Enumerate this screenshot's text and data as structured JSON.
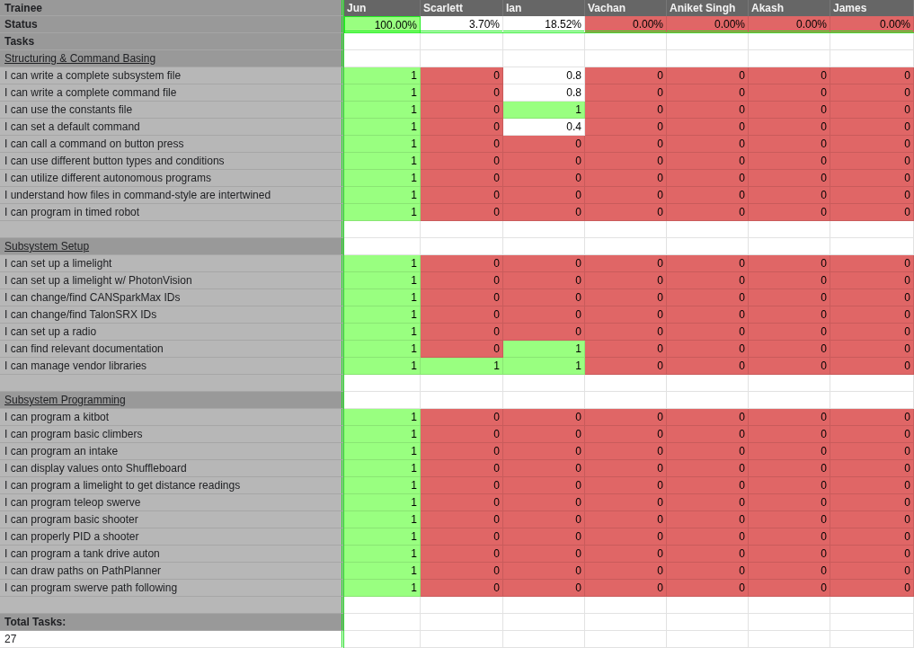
{
  "header": {
    "label": "Trainee",
    "trainees": [
      "Jun",
      "Scarlett",
      "Ian",
      "Vachan",
      "Aniket Singh",
      "Akash",
      "James"
    ]
  },
  "status": {
    "label": "Status",
    "cells": [
      {
        "value": "100.00%",
        "color": "#99ff80"
      },
      {
        "value": "3.70%",
        "color": "#ffffff"
      },
      {
        "value": "18.52%",
        "color": "#ffffff"
      },
      {
        "value": "0.00%",
        "color": "#e06666"
      },
      {
        "value": "0.00%",
        "color": "#e06666"
      },
      {
        "value": "0.00%",
        "color": "#e06666"
      },
      {
        "value": "0.00%",
        "color": "#e06666"
      }
    ]
  },
  "tasks_label": "Tasks",
  "sections": [
    {
      "title": "Structuring & Command Basing",
      "rows": [
        {
          "label": "I can write a complete subsystem file",
          "cells": [
            {
              "value": "1",
              "color": "#99ff80"
            },
            {
              "value": "0",
              "color": "#e06666"
            },
            {
              "value": "0.8",
              "color": "#ffffff"
            },
            {
              "value": "0",
              "color": "#e06666"
            },
            {
              "value": "0",
              "color": "#e06666"
            },
            {
              "value": "0",
              "color": "#e06666"
            },
            {
              "value": "0",
              "color": "#e06666"
            }
          ]
        },
        {
          "label": "I can write a complete command file",
          "cells": [
            {
              "value": "1",
              "color": "#99ff80"
            },
            {
              "value": "0",
              "color": "#e06666"
            },
            {
              "value": "0.8",
              "color": "#ffffff"
            },
            {
              "value": "0",
              "color": "#e06666"
            },
            {
              "value": "0",
              "color": "#e06666"
            },
            {
              "value": "0",
              "color": "#e06666"
            },
            {
              "value": "0",
              "color": "#e06666"
            }
          ]
        },
        {
          "label": "I can use the constants file",
          "cells": [
            {
              "value": "1",
              "color": "#99ff80"
            },
            {
              "value": "0",
              "color": "#e06666"
            },
            {
              "value": "1",
              "color": "#99ff80"
            },
            {
              "value": "0",
              "color": "#e06666"
            },
            {
              "value": "0",
              "color": "#e06666"
            },
            {
              "value": "0",
              "color": "#e06666"
            },
            {
              "value": "0",
              "color": "#e06666"
            }
          ]
        },
        {
          "label": "I can set a default command",
          "cells": [
            {
              "value": "1",
              "color": "#99ff80"
            },
            {
              "value": "0",
              "color": "#e06666"
            },
            {
              "value": "0.4",
              "color": "#ffffff"
            },
            {
              "value": "0",
              "color": "#e06666"
            },
            {
              "value": "0",
              "color": "#e06666"
            },
            {
              "value": "0",
              "color": "#e06666"
            },
            {
              "value": "0",
              "color": "#e06666"
            }
          ]
        },
        {
          "label": "I can call a command on button press",
          "cells": [
            {
              "value": "1",
              "color": "#99ff80"
            },
            {
              "value": "0",
              "color": "#e06666"
            },
            {
              "value": "0",
              "color": "#e06666"
            },
            {
              "value": "0",
              "color": "#e06666"
            },
            {
              "value": "0",
              "color": "#e06666"
            },
            {
              "value": "0",
              "color": "#e06666"
            },
            {
              "value": "0",
              "color": "#e06666"
            }
          ]
        },
        {
          "label": "I can use different button types and conditions",
          "cells": [
            {
              "value": "1",
              "color": "#99ff80"
            },
            {
              "value": "0",
              "color": "#e06666"
            },
            {
              "value": "0",
              "color": "#e06666"
            },
            {
              "value": "0",
              "color": "#e06666"
            },
            {
              "value": "0",
              "color": "#e06666"
            },
            {
              "value": "0",
              "color": "#e06666"
            },
            {
              "value": "0",
              "color": "#e06666"
            }
          ]
        },
        {
          "label": "I can utilize different autonomous programs",
          "cells": [
            {
              "value": "1",
              "color": "#99ff80"
            },
            {
              "value": "0",
              "color": "#e06666"
            },
            {
              "value": "0",
              "color": "#e06666"
            },
            {
              "value": "0",
              "color": "#e06666"
            },
            {
              "value": "0",
              "color": "#e06666"
            },
            {
              "value": "0",
              "color": "#e06666"
            },
            {
              "value": "0",
              "color": "#e06666"
            }
          ]
        },
        {
          "label": "I understand how files in command-style are intertwined",
          "cells": [
            {
              "value": "1",
              "color": "#99ff80"
            },
            {
              "value": "0",
              "color": "#e06666"
            },
            {
              "value": "0",
              "color": "#e06666"
            },
            {
              "value": "0",
              "color": "#e06666"
            },
            {
              "value": "0",
              "color": "#e06666"
            },
            {
              "value": "0",
              "color": "#e06666"
            },
            {
              "value": "0",
              "color": "#e06666"
            }
          ]
        },
        {
          "label": "I can program in timed robot",
          "cells": [
            {
              "value": "1",
              "color": "#99ff80"
            },
            {
              "value": "0",
              "color": "#e06666"
            },
            {
              "value": "0",
              "color": "#e06666"
            },
            {
              "value": "0",
              "color": "#e06666"
            },
            {
              "value": "0",
              "color": "#e06666"
            },
            {
              "value": "0",
              "color": "#e06666"
            },
            {
              "value": "0",
              "color": "#e06666"
            }
          ]
        }
      ]
    },
    {
      "title": "Subsystem Setup",
      "rows": [
        {
          "label": "I can set up a limelight",
          "cells": [
            {
              "value": "1",
              "color": "#99ff80"
            },
            {
              "value": "0",
              "color": "#e06666"
            },
            {
              "value": "0",
              "color": "#e06666"
            },
            {
              "value": "0",
              "color": "#e06666"
            },
            {
              "value": "0",
              "color": "#e06666"
            },
            {
              "value": "0",
              "color": "#e06666"
            },
            {
              "value": "0",
              "color": "#e06666"
            }
          ]
        },
        {
          "label": "I can set up a limelight w/ PhotonVision",
          "cells": [
            {
              "value": "1",
              "color": "#99ff80"
            },
            {
              "value": "0",
              "color": "#e06666"
            },
            {
              "value": "0",
              "color": "#e06666"
            },
            {
              "value": "0",
              "color": "#e06666"
            },
            {
              "value": "0",
              "color": "#e06666"
            },
            {
              "value": "0",
              "color": "#e06666"
            },
            {
              "value": "0",
              "color": "#e06666"
            }
          ]
        },
        {
          "label": "I can change/find CANSparkMax IDs",
          "cells": [
            {
              "value": "1",
              "color": "#99ff80"
            },
            {
              "value": "0",
              "color": "#e06666"
            },
            {
              "value": "0",
              "color": "#e06666"
            },
            {
              "value": "0",
              "color": "#e06666"
            },
            {
              "value": "0",
              "color": "#e06666"
            },
            {
              "value": "0",
              "color": "#e06666"
            },
            {
              "value": "0",
              "color": "#e06666"
            }
          ]
        },
        {
          "label": "I can change/find TalonSRX IDs",
          "cells": [
            {
              "value": "1",
              "color": "#99ff80"
            },
            {
              "value": "0",
              "color": "#e06666"
            },
            {
              "value": "0",
              "color": "#e06666"
            },
            {
              "value": "0",
              "color": "#e06666"
            },
            {
              "value": "0",
              "color": "#e06666"
            },
            {
              "value": "0",
              "color": "#e06666"
            },
            {
              "value": "0",
              "color": "#e06666"
            }
          ]
        },
        {
          "label": "I can set up a radio",
          "cells": [
            {
              "value": "1",
              "color": "#99ff80"
            },
            {
              "value": "0",
              "color": "#e06666"
            },
            {
              "value": "0",
              "color": "#e06666"
            },
            {
              "value": "0",
              "color": "#e06666"
            },
            {
              "value": "0",
              "color": "#e06666"
            },
            {
              "value": "0",
              "color": "#e06666"
            },
            {
              "value": "0",
              "color": "#e06666"
            }
          ]
        },
        {
          "label": "I can find relevant documentation",
          "cells": [
            {
              "value": "1",
              "color": "#99ff80"
            },
            {
              "value": "0",
              "color": "#e06666"
            },
            {
              "value": "1",
              "color": "#99ff80"
            },
            {
              "value": "0",
              "color": "#e06666"
            },
            {
              "value": "0",
              "color": "#e06666"
            },
            {
              "value": "0",
              "color": "#e06666"
            },
            {
              "value": "0",
              "color": "#e06666"
            }
          ]
        },
        {
          "label": "I can manage vendor libraries",
          "cells": [
            {
              "value": "1",
              "color": "#99ff80"
            },
            {
              "value": "1",
              "color": "#99ff80"
            },
            {
              "value": "1",
              "color": "#99ff80"
            },
            {
              "value": "0",
              "color": "#e06666"
            },
            {
              "value": "0",
              "color": "#e06666"
            },
            {
              "value": "0",
              "color": "#e06666"
            },
            {
              "value": "0",
              "color": "#e06666"
            }
          ]
        }
      ]
    },
    {
      "title": "Subsystem Programming",
      "rows": [
        {
          "label": "I can program a kitbot",
          "cells": [
            {
              "value": "1",
              "color": "#99ff80"
            },
            {
              "value": "0",
              "color": "#e06666"
            },
            {
              "value": "0",
              "color": "#e06666"
            },
            {
              "value": "0",
              "color": "#e06666"
            },
            {
              "value": "0",
              "color": "#e06666"
            },
            {
              "value": "0",
              "color": "#e06666"
            },
            {
              "value": "0",
              "color": "#e06666"
            }
          ]
        },
        {
          "label": "I can program basic climbers",
          "cells": [
            {
              "value": "1",
              "color": "#99ff80"
            },
            {
              "value": "0",
              "color": "#e06666"
            },
            {
              "value": "0",
              "color": "#e06666"
            },
            {
              "value": "0",
              "color": "#e06666"
            },
            {
              "value": "0",
              "color": "#e06666"
            },
            {
              "value": "0",
              "color": "#e06666"
            },
            {
              "value": "0",
              "color": "#e06666"
            }
          ]
        },
        {
          "label": "I can program an intake",
          "cells": [
            {
              "value": "1",
              "color": "#99ff80"
            },
            {
              "value": "0",
              "color": "#e06666"
            },
            {
              "value": "0",
              "color": "#e06666"
            },
            {
              "value": "0",
              "color": "#e06666"
            },
            {
              "value": "0",
              "color": "#e06666"
            },
            {
              "value": "0",
              "color": "#e06666"
            },
            {
              "value": "0",
              "color": "#e06666"
            }
          ]
        },
        {
          "label": "I can display values onto Shuffleboard",
          "cells": [
            {
              "value": "1",
              "color": "#99ff80"
            },
            {
              "value": "0",
              "color": "#e06666"
            },
            {
              "value": "0",
              "color": "#e06666"
            },
            {
              "value": "0",
              "color": "#e06666"
            },
            {
              "value": "0",
              "color": "#e06666"
            },
            {
              "value": "0",
              "color": "#e06666"
            },
            {
              "value": "0",
              "color": "#e06666"
            }
          ]
        },
        {
          "label": "I can program a limelight to get distance readings",
          "cells": [
            {
              "value": "1",
              "color": "#99ff80"
            },
            {
              "value": "0",
              "color": "#e06666"
            },
            {
              "value": "0",
              "color": "#e06666"
            },
            {
              "value": "0",
              "color": "#e06666"
            },
            {
              "value": "0",
              "color": "#e06666"
            },
            {
              "value": "0",
              "color": "#e06666"
            },
            {
              "value": "0",
              "color": "#e06666"
            }
          ]
        },
        {
          "label": "I can program teleop swerve",
          "cells": [
            {
              "value": "1",
              "color": "#99ff80"
            },
            {
              "value": "0",
              "color": "#e06666"
            },
            {
              "value": "0",
              "color": "#e06666"
            },
            {
              "value": "0",
              "color": "#e06666"
            },
            {
              "value": "0",
              "color": "#e06666"
            },
            {
              "value": "0",
              "color": "#e06666"
            },
            {
              "value": "0",
              "color": "#e06666"
            }
          ]
        },
        {
          "label": "I can program basic shooter",
          "cells": [
            {
              "value": "1",
              "color": "#99ff80"
            },
            {
              "value": "0",
              "color": "#e06666"
            },
            {
              "value": "0",
              "color": "#e06666"
            },
            {
              "value": "0",
              "color": "#e06666"
            },
            {
              "value": "0",
              "color": "#e06666"
            },
            {
              "value": "0",
              "color": "#e06666"
            },
            {
              "value": "0",
              "color": "#e06666"
            }
          ]
        },
        {
          "label": "I can properly PID a shooter",
          "cells": [
            {
              "value": "1",
              "color": "#99ff80"
            },
            {
              "value": "0",
              "color": "#e06666"
            },
            {
              "value": "0",
              "color": "#e06666"
            },
            {
              "value": "0",
              "color": "#e06666"
            },
            {
              "value": "0",
              "color": "#e06666"
            },
            {
              "value": "0",
              "color": "#e06666"
            },
            {
              "value": "0",
              "color": "#e06666"
            }
          ]
        },
        {
          "label": "I can program a tank drive auton",
          "cells": [
            {
              "value": "1",
              "color": "#99ff80"
            },
            {
              "value": "0",
              "color": "#e06666"
            },
            {
              "value": "0",
              "color": "#e06666"
            },
            {
              "value": "0",
              "color": "#e06666"
            },
            {
              "value": "0",
              "color": "#e06666"
            },
            {
              "value": "0",
              "color": "#e06666"
            },
            {
              "value": "0",
              "color": "#e06666"
            }
          ]
        },
        {
          "label": "I can draw paths on PathPlanner",
          "cells": [
            {
              "value": "1",
              "color": "#99ff80"
            },
            {
              "value": "0",
              "color": "#e06666"
            },
            {
              "value": "0",
              "color": "#e06666"
            },
            {
              "value": "0",
              "color": "#e06666"
            },
            {
              "value": "0",
              "color": "#e06666"
            },
            {
              "value": "0",
              "color": "#e06666"
            },
            {
              "value": "0",
              "color": "#e06666"
            }
          ]
        },
        {
          "label": "I can program swerve path following",
          "cells": [
            {
              "value": "1",
              "color": "#99ff80"
            },
            {
              "value": "0",
              "color": "#e06666"
            },
            {
              "value": "0",
              "color": "#e06666"
            },
            {
              "value": "0",
              "color": "#e06666"
            },
            {
              "value": "0",
              "color": "#e06666"
            },
            {
              "value": "0",
              "color": "#e06666"
            },
            {
              "value": "0",
              "color": "#e06666"
            }
          ]
        }
      ]
    }
  ],
  "total": {
    "label": "Total Tasks:",
    "value": "27"
  }
}
